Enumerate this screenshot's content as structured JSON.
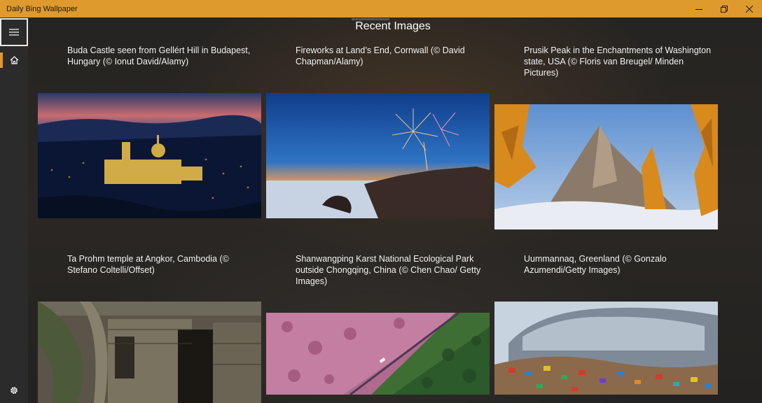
{
  "window": {
    "title": "Daily Bing Wallpaper"
  },
  "main": {
    "heading": "Recent Images",
    "images": [
      {
        "caption": "Buda Castle seen from Gellért Hill in Budapest, Hungary (© Ionut David/Alamy)"
      },
      {
        "caption": "Fireworks at Land’s End, Cornwall (© David Chapman/Alamy)"
      },
      {
        "caption": "Prusik Peak in the Enchantments of Washington state, USA (© Floris van Breugel/ Minden Pictures)"
      },
      {
        "caption": "Ta Prohm temple at Angkor, Cambodia (© Stefano Coltelli/Offset)"
      },
      {
        "caption": "Shanwangping Karst National Ecological Park outside Chongqing, China (© Chen Chao/ Getty Images)"
      },
      {
        "caption": "Uummannaq, Greenland (© Gonzalo Azumendi/Getty Images)"
      }
    ]
  },
  "colors": {
    "accent": "#DE9A2C",
    "sidebar": "#2b2b2b"
  },
  "icons": {
    "menu": "hamburger-menu-icon",
    "home": "home-icon",
    "settings": "gear-icon",
    "minimize": "minimize-icon",
    "maximize": "restore-icon",
    "close": "close-icon"
  }
}
